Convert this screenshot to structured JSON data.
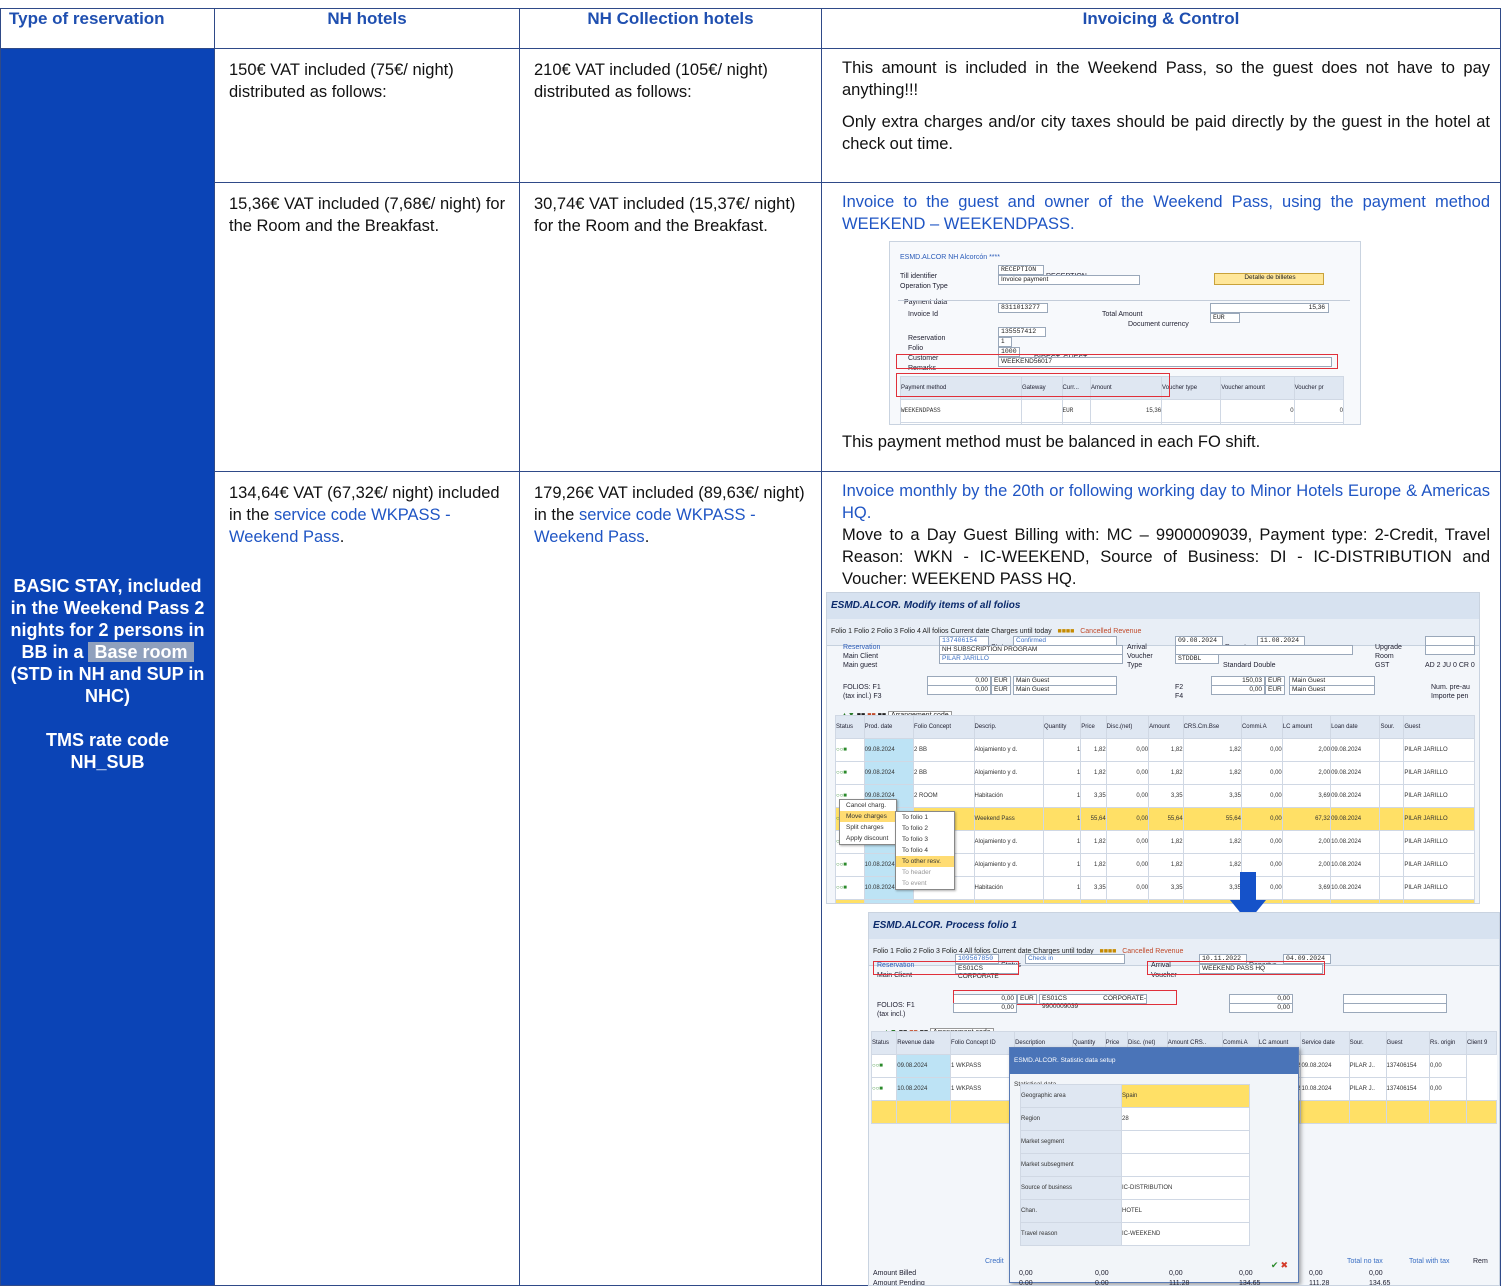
{
  "headers": {
    "type": "Type of reservation",
    "nh": "NH hotels",
    "nhc": "NH Collection hotels",
    "inv": "Invoicing & Control"
  },
  "type_cell": {
    "line1": "BASIC STAY, included in the Weekend Pass 2 nights for 2 persons in BB in a",
    "base_room": "Base room",
    "line2": "(STD in NH and SUP in NHC)",
    "rate_label": "TMS rate code NH_SUB"
  },
  "rows": [
    {
      "nh": "150€ VAT included (75€/ night) distributed as follows:",
      "nhc": "210€ VAT included (105€/ night) distributed as follows:",
      "inv_p1": "This amount is included in the Weekend Pass, so the guest does not have to pay anything!!!",
      "inv_p2": "Only extra charges and/or city taxes should be paid directly by the guest in the hotel at check out time."
    },
    {
      "nh": "15,36€ VAT included (7,68€/ night) for the Room and the Breakfast.",
      "nhc": "30,74€ VAT included (15,37€/ night) for the Room and the Breakfast.",
      "inv_p1": "Invoice to the guest and owner of the Weekend Pass, using the payment method WEEKEND – WEEKENDPASS.",
      "inv_p2": "This payment method must be balanced in each FO shift."
    },
    {
      "nh_a": "134,64€ VAT (67,32€/ night) included in the ",
      "nh_link": "service code WKPASS - Weekend Pass",
      "nh_b": ".",
      "nhc_a": "179,26€ VAT included (89,63€/ night) in the ",
      "nhc_link": "service code WKPASS - Weekend Pass",
      "nhc_b": ".",
      "inv_p1": "Invoice monthly by the 20th or following working day to Minor Hotels Europe & Americas HQ.",
      "inv_p2": "Move to a Day Guest Billing with: MC – 9900009039, Payment type: 2-Credit, Travel Reason: WKN - IC-WEEKEND, Source of Business: DI - IC-DISTRIBUTION and Voucher: WEEKEND PASS HQ."
    }
  ],
  "shot1": {
    "title": "ESMD.ALCOR NH Alcorcón ****",
    "till_label": "Till identifier",
    "till_value": "RECEPTION",
    "till_desc": "RECEPTION",
    "op_label": "Operation Type",
    "op_value": "Invoice payment",
    "detail_btn": "Detalle de billetes",
    "section": "Payment data",
    "invoice_label": "Invoice Id",
    "invoice_value": "8311013277",
    "total_label": "Total Amount",
    "total_value": "15,36",
    "doccur_label": "Document currency",
    "doccur_value": "EUR",
    "res_label": "Reservation",
    "res_value": "135557412",
    "folio_label": "Folio",
    "folio_value": "1",
    "cust_label": "Customer",
    "cust_value": "1000",
    "cust_desc": "DIRECT, GUEST",
    "remarks_label": "Remarks",
    "remarks_value": "WEEKEND56017",
    "col_pm": "Payment method",
    "col_gw": "Gateway",
    "col_cur": "Curr...",
    "col_amt": "Amount",
    "col_vt": "Voucher type",
    "col_va": "Voucher amount",
    "col_vp": "Voucher pr",
    "pm_value": "WEEKENDPASS",
    "cur_value": "EUR",
    "amt_value": "15,36",
    "va_value": "0",
    "vp_value": "0"
  },
  "shot2": {
    "title": "ESMD.ALCOR. Modify items of all folios",
    "toolbar": "Folio 1   Folio 2   Folio 3   Folio 4   All folios   Current date   Charges until today",
    "cancelled": "Cancelled Revenue",
    "res_label": "Reservation",
    "res_value": "137406154",
    "status_label": "Status",
    "status_value": "Confirmed",
    "arrival_label": "Arrival",
    "arrival_value": "09.08.2024",
    "depart_label": "Departur",
    "depart_value": "11.08.2024",
    "upgrade_label": "Upgrade",
    "client_label": "Main Client",
    "client_value": "NH SUBSCRIPTION PROGRAM",
    "voucher_label": "Voucher",
    "room_label": "Room",
    "guest_label": "Main guest",
    "guest_value": "PILAR JARILLO",
    "type_label": "Type",
    "type_value": "STDDBL",
    "type_desc": "Standard Double",
    "gst_label": "GST",
    "gst_value": "AD 2  JU 0  CR 0",
    "folios_label": "FOLIOS:  F1",
    "taxinc_label": "(tax incl.)  F3",
    "f1_amt": "0,00",
    "f1_cur": "EUR",
    "f1_who": "Main Guest",
    "f3_amt": "0,00",
    "f3_cur": "EUR",
    "f3_who": "Main Guest",
    "f2_label": "F2",
    "f2_amt": "150,03",
    "f2_cur": "EUR",
    "f2_who": "Main Guest",
    "f4_label": "F4",
    "f4_amt": "0,00",
    "f4_cur": "EUR",
    "f4_who": "Main Guest",
    "num_pre": "Num. pre-au",
    "importe": "Importe pen",
    "arrangement": "Arrangement code",
    "cols": [
      "Status",
      "Prod. date",
      "Folio Concept",
      "Descrip.",
      "Quantity",
      "Price",
      "Disc.(net)",
      "Amount",
      "CRS.Cm.Bse",
      "Commi.A",
      "LC amount",
      "Loan date",
      "Sour.",
      "Guest"
    ],
    "rows": [
      [
        "09.08.2024",
        "2 BB",
        "Alojamiento y d.",
        "1",
        "1,82",
        "0,00",
        "1,82",
        "1,82",
        "0,00",
        "2,00",
        "09.08.2024",
        "PILAR JARILLO"
      ],
      [
        "09.08.2024",
        "2 BB",
        "Alojamiento y d.",
        "1",
        "1,82",
        "0,00",
        "1,82",
        "1,82",
        "0,00",
        "2,00",
        "09.08.2024",
        "PILAR JARILLO"
      ],
      [
        "09.08.2024",
        "2 ROOM",
        "Habitación",
        "1",
        "3,35",
        "0,00",
        "3,35",
        "3,35",
        "0,00",
        "3,69",
        "09.08.2024",
        "PILAR JARILLO"
      ],
      [
        "09.08.2024",
        "2 WKPASS",
        "Weekend Pass",
        "1",
        "55,64",
        "0,00",
        "55,64",
        "55,64",
        "0,00",
        "67,32",
        "09.08.2024",
        "PILAR JARILLO"
      ],
      [
        "10.08.2024",
        "2 BB",
        "Alojamiento y d.",
        "1",
        "1,82",
        "0,00",
        "1,82",
        "1,82",
        "0,00",
        "2,00",
        "10.08.2024",
        "PILAR JARILLO"
      ],
      [
        "10.08.2024",
        "2 BB",
        "Alojamiento y d.",
        "1",
        "1,82",
        "0,00",
        "1,82",
        "1,82",
        "0,00",
        "2,00",
        "10.08.2024",
        "PILAR JARILLO"
      ],
      [
        "10.08.2024",
        "2 ROOM",
        "Habitación",
        "1",
        "3,35",
        "0,00",
        "3,35",
        "3,35",
        "0,00",
        "3,69",
        "10.08.2024",
        "PILAR JARILLO"
      ],
      [
        "10.08.2024",
        "2 WKPASS",
        "Weekend Pass",
        "1",
        "55,64",
        "0,00",
        "55,64",
        "55,64",
        "0,00",
        "67,32",
        "10.08.2024",
        "PILAR JARILLO"
      ]
    ],
    "total": "125,26",
    "menu1": [
      "Cancel charg.",
      "Move charges",
      "Split charges",
      "Apply discount"
    ],
    "menu2": [
      "To folio 1",
      "To folio 2",
      "To folio 3",
      "To folio 4",
      "To other resv.",
      "To header",
      "To event"
    ]
  },
  "shot3": {
    "title": "ESMD.ALCOR. Process folio 1",
    "toolbar": "Folio 1   Folio 2   Folio 3   Folio 4   All folios   Current date   Charges until today",
    "cancelled": "Cancelled Revenue",
    "res_label": "Reservation",
    "res_value": "109567850",
    "status_label": "Status",
    "status_value": "Check in",
    "arrival_label": "Arrival",
    "arrival_value": "10.11.2022",
    "depart_label": "Departur",
    "depart_value": "04.09.2024",
    "client_label": "Main Client",
    "client_value": "ES01CS CORPORATE",
    "voucher_label": "Voucher",
    "voucher_value": "WEEKEND PASS HQ",
    "folios_label": "FOLIOS:  F1",
    "taxinc_label": "(tax incl.)",
    "f1_amt": "0,00",
    "f1_cur": "EUR",
    "f1_corp": "ES01CS CORPORATE-9900009039",
    "f1b_amt": "0,00",
    "r1_amt": "0,00",
    "r2_amt": "0,00",
    "arrangement": "Arrangement code",
    "cols": [
      "Status",
      "Revenue date",
      "Folio Concept ID",
      "Description",
      "Quantity",
      "Price",
      "Disc. (net)",
      "Amount CRS..",
      "Commi.A",
      "LC amount",
      "Service date",
      "Sour.",
      "Guest",
      "Rs. origin",
      "Client 9"
    ],
    "rows": [
      [
        "09.08.2024",
        "1 WKPASS",
        "Weekend Pass",
        "1",
        "55,64",
        "0,00",
        "55,64  55,64",
        "0,00",
        "67,32",
        "09.08.2024",
        "PILAR J..",
        "137406154",
        "0,00"
      ],
      [
        "10.08.2024",
        "1 WKPASS",
        "Weekend Pass",
        "1",
        "55,64",
        "0,00",
        "55,64  55,64",
        "0,00",
        "67,32",
        "10.08.2024",
        "PILAR J..",
        "137406154",
        "0,00"
      ]
    ],
    "total": "111,28",
    "dialog_title": "ESMD.ALCOR. Statistic data setup",
    "dialog_section": "Statistical data",
    "dialog_fields": [
      {
        "label": "Geographic area",
        "value": "Spain"
      },
      {
        "label": "Region",
        "value": "28"
      },
      {
        "label": "Market segment",
        "value": ""
      },
      {
        "label": "Market subsegment",
        "value": ""
      },
      {
        "label": "Source of business",
        "value": "IC-DISTRIBUTION"
      },
      {
        "label": "Chan.",
        "value": "HOTEL"
      },
      {
        "label": "Travel reason",
        "value": "IC-WEEKEND"
      }
    ],
    "credit_label": "Credit",
    "total_notax": "Total no tax",
    "total_tax": "Total with tax",
    "rem": "Rem",
    "billed_label": "Amount Billed",
    "pending_label": "Amount Pending",
    "billed": [
      "0,00",
      "0,00",
      "0,00",
      "0,00",
      "0,00",
      "0,00"
    ],
    "pending": [
      "0,00",
      "0,00",
      "111,28",
      "134,65",
      "111,28",
      "134,65"
    ]
  },
  "colors": {
    "header_blue": "#1f4fb0",
    "type_cell_bg": "#0b44b6",
    "link_blue": "#1f55c4",
    "arrow_blue": "#1552c9"
  }
}
